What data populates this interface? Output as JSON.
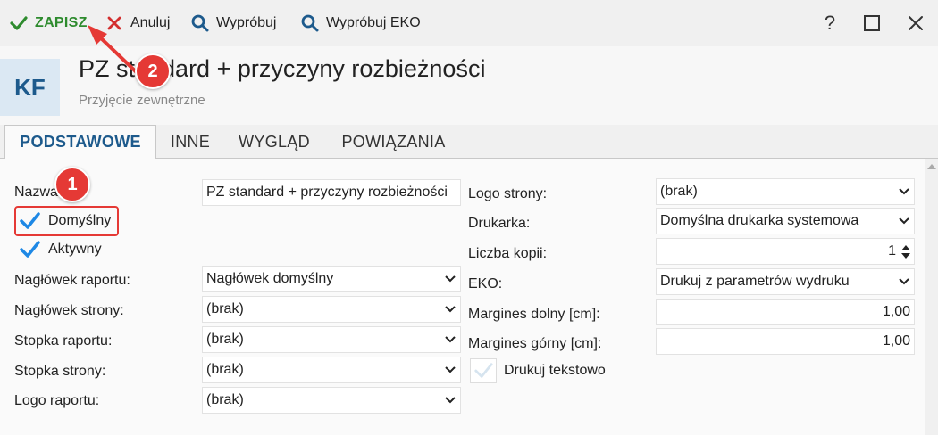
{
  "toolbar": {
    "save_label": "ZAPISZ",
    "cancel_label": "Anuluj",
    "try_label": "Wypróbuj",
    "try_eko_label": "Wypróbuj EKO",
    "help_label": "?",
    "close_label": "✕"
  },
  "header": {
    "avatar": "KF",
    "title": "PZ standard + przyczyny rozbieżności",
    "subtitle": "Przyjęcie zewnętrzne"
  },
  "tabs": [
    {
      "label": "PODSTAWOWE",
      "active": true
    },
    {
      "label": "INNE"
    },
    {
      "label": "WYGLĄD"
    },
    {
      "label": "POWIĄZANIA"
    }
  ],
  "left": {
    "name_label": "Nazwa:",
    "name_value": "PZ standard + przyczyny rozbieżności",
    "default_label": "Domyślny",
    "default_checked": true,
    "active_label": "Aktywny",
    "active_checked": true,
    "report_header_label": "Nagłówek raportu:",
    "report_header_value": "Nagłówek domyślny",
    "page_header_label": "Nagłówek strony:",
    "page_header_value": "(brak)",
    "report_footer_label": "Stopka raportu:",
    "report_footer_value": "(brak)",
    "page_footer_label": "Stopka strony:",
    "page_footer_value": "(brak)",
    "report_logo_label": "Logo raportu:",
    "report_logo_value": "(brak)"
  },
  "right": {
    "page_logo_label": "Logo strony:",
    "page_logo_value": "(brak)",
    "printer_label": "Drukarka:",
    "printer_value": "Domyślna drukarka systemowa",
    "copies_label": "Liczba kopii:",
    "copies_value": "1",
    "eko_label": "EKO:",
    "eko_value": "Drukuj z parametrów wydruku",
    "margin_bottom_label": "Margines dolny [cm]:",
    "margin_bottom_value": "1,00",
    "margin_top_label": "Margines górny [cm]:",
    "margin_top_value": "1,00",
    "text_print_label": "Drukuj tekstowo",
    "text_print_checked": false
  },
  "annotations": {
    "badge_1": "1",
    "badge_2": "2",
    "color": "#e53935"
  },
  "colors": {
    "accent": "#1d5a8c",
    "save": "#2e8b2e",
    "cancel": "#d32f2f",
    "check": "#1e88e5"
  }
}
